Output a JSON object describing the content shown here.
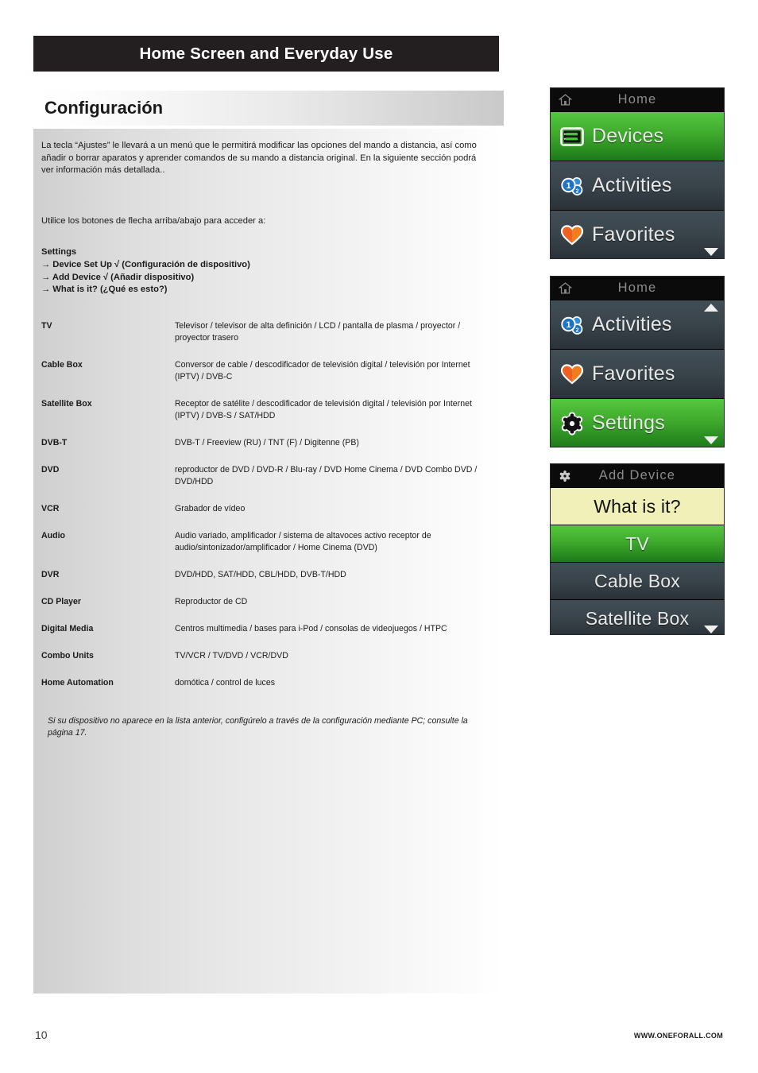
{
  "chapter": {
    "title": "Home Screen and Everyday Use"
  },
  "section": {
    "title": "Configuración"
  },
  "body": {
    "intro": "La tecla “Ajustes” le llevará a un menú que le permitirá modificar las opciones del mando a distancia, así como añadir o borrar aparatos y aprender comandos de su mando a distancia original. En la siguiente sección podrá ver información más detallada..",
    "instruction": "Utilice los botones de flecha arriba/abajo para acceder a:",
    "menu_heading": "Settings",
    "menu_items": [
      "→ Device Set Up √ (Configuración de dispositivo)",
      "→ Add Device √ (Añadir dispositivo)",
      "→ What is it? (¿Qué es esto?)"
    ],
    "note": "Si su dispositivo no aparece en la lista anterior, configúrelo a través de la configuración mediante PC; consulte la página 17."
  },
  "device_table": [
    {
      "term": "TV",
      "definition": "Televisor / televisor de alta definición / LCD / pantalla de plasma / proyector / proyector trasero"
    },
    {
      "term": "Cable Box",
      "definition": "Conversor de cable / descodificador de televisión digital / televisión por Internet (IPTV) / DVB-C"
    },
    {
      "term": "Satellite Box",
      "definition": "Receptor de satélite / descodificador de televisión digital / televisión por Internet (IPTV) / DVB-S / SAT/HDD"
    },
    {
      "term": "DVB-T",
      "definition": "DVB-T / Freeview (RU) / TNT (F) / Digitenne (PB)"
    },
    {
      "term": "DVD",
      "definition": "reproductor de DVD / DVD-R / Blu-ray / DVD Home Cinema / DVD Combo DVD / DVD/HDD"
    },
    {
      "term": "VCR",
      "definition": "Grabador de vídeo"
    },
    {
      "term": "Audio",
      "definition": "Audio variado, amplificador / sistema de altavoces activo receptor de audio/sintonizador/amplificador / Home Cinema (DVD)"
    },
    {
      "term": "DVR",
      "definition": "DVD/HDD, SAT/HDD, CBL/HDD, DVB-T/HDD"
    },
    {
      "term": "CD Player",
      "definition": "Reproductor de CD"
    },
    {
      "term": "Digital Media",
      "definition": "Centros multimedia / bases para i-Pod / consolas de videojuegos / HTPC"
    },
    {
      "term": "Combo Units",
      "definition": "TV/VCR / TV/DVD / VCR/DVD"
    },
    {
      "term": "Home Automation",
      "definition": "domótica / control de luces"
    }
  ],
  "screens": [
    {
      "header_label": "Home",
      "header_icon": "home-icon",
      "rows": [
        {
          "label": "Devices",
          "icon": "device-rack-icon",
          "state": "selected"
        },
        {
          "label": "Activities",
          "icon": "activities-bubbles-icon",
          "state": "normal"
        },
        {
          "label": "Favorites",
          "icon": "heart-icon",
          "state": "normal"
        }
      ],
      "scroll": "down"
    },
    {
      "header_label": "Home",
      "header_icon": "home-icon",
      "rows": [
        {
          "label": "Activities",
          "icon": "activities-bubbles-icon",
          "state": "normal"
        },
        {
          "label": "Favorites",
          "icon": "heart-icon",
          "state": "normal"
        },
        {
          "label": "Settings",
          "icon": "gear-icon",
          "state": "selected"
        }
      ],
      "scroll": "both"
    },
    {
      "header_label": "Add Device",
      "header_icon": "gear-icon",
      "rows": [
        {
          "label": "What is it?",
          "icon": "",
          "state": "highlight"
        },
        {
          "label": "TV",
          "icon": "",
          "state": "selected"
        },
        {
          "label": "Cable Box",
          "icon": "",
          "state": "normal"
        },
        {
          "label": "Satellite Box",
          "icon": "",
          "state": "normal"
        }
      ],
      "scroll": "down"
    }
  ],
  "footer": {
    "page_number": "10",
    "website": "WWW.ONEFORALL.COM"
  },
  "colors": {
    "chapter_bar": "#231f20",
    "selected_green_top": "#55c73f",
    "selected_green_bottom": "#1d7a1a",
    "row_dark_top": "#424e56",
    "row_dark_bottom": "#2a3238",
    "highlight_yellow": "#f1f0b9",
    "header_text": "#8b8b8b"
  }
}
